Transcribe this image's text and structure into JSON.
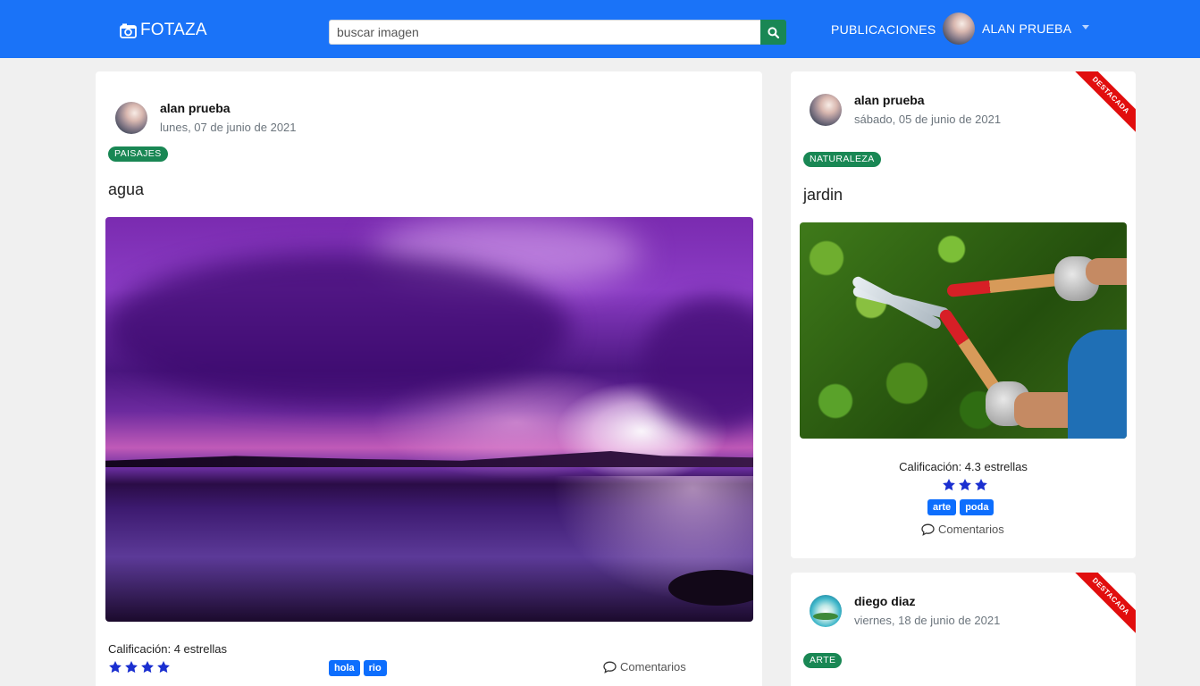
{
  "navbar": {
    "brand": "FOTAZA",
    "search_placeholder": "buscar imagen",
    "publications": "PUBLICACIONES",
    "user_name": "ALAN PRUEBA"
  },
  "posts": [
    {
      "author": "alan prueba",
      "date": "lunes, 07 de junio de 2021",
      "category": "PAISAJES",
      "title": "agua",
      "rating_label": "Calificación: 4 estrellas",
      "rating": 4,
      "tags": [
        "hola",
        "rio"
      ],
      "comments": "Comentarios",
      "featured": false
    },
    {
      "author": "alan prueba",
      "date": "sábado, 05 de junio de 2021",
      "category": "NATURALEZA",
      "title": "jardin",
      "rating_label": "Calificación: 4.3 estrellas",
      "rating": 3,
      "tags": [
        "arte",
        "poda"
      ],
      "comments": "Comentarios",
      "featured": true,
      "ribbon": "DESTACADA"
    },
    {
      "author": "diego diaz",
      "date": "viernes, 18 de junio de 2021",
      "category": "ARTE",
      "featured": true,
      "ribbon": "DESTACADA"
    }
  ],
  "icons": {
    "brand": "camera-icon",
    "search": "search-icon",
    "comment": "speech-bubble-icon",
    "star": "star-icon"
  },
  "colors": {
    "navbar": "#1a73f8",
    "category_badge": "#198754",
    "tag": "#0d6efd",
    "star": "#1a2fd0",
    "ribbon": "#e10e0e"
  }
}
